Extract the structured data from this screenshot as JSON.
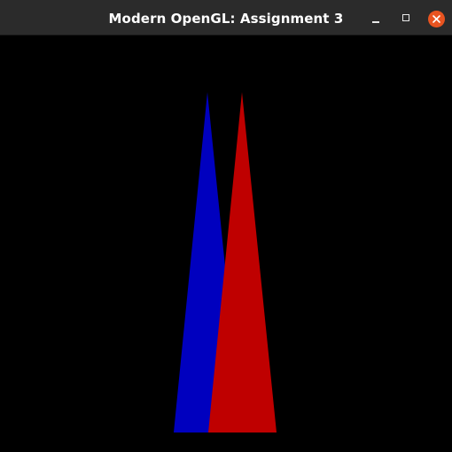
{
  "window": {
    "title": "Modern OpenGL: Assignment 3"
  },
  "controls": {
    "minimize_icon": "minimize-icon",
    "maximize_icon": "maximize-icon",
    "close_icon": "close-icon"
  },
  "colors": {
    "titlebar": "#2b2b2b",
    "title_text": "#ffffff",
    "close_accent": "#e95420",
    "canvas_background": "#000000",
    "blue_triangle": "#0000bf",
    "red_triangle": "#bf0000"
  }
}
